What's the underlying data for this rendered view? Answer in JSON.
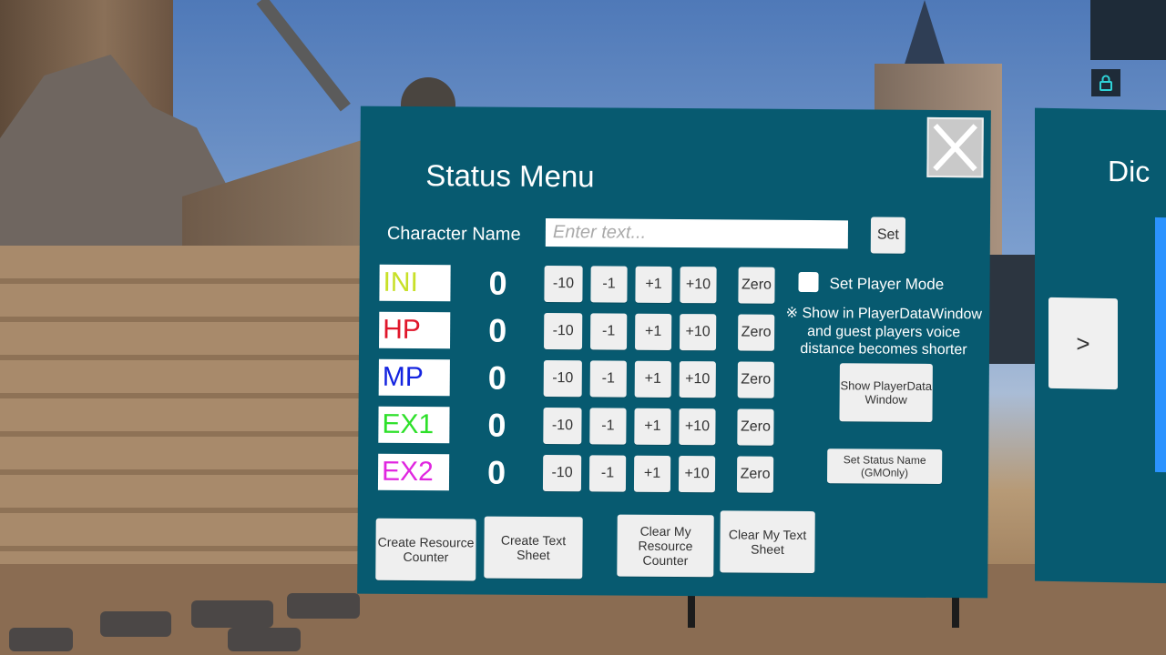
{
  "status_menu": {
    "title": "Status Menu",
    "close_icon": "close-x-icon",
    "character_name": {
      "label": "Character Name",
      "value": "",
      "placeholder": "Enter text...",
      "set_label": "Set"
    },
    "stats": [
      {
        "name": "INI",
        "value": "0",
        "color": "#c8e028"
      },
      {
        "name": "HP",
        "value": "0",
        "color": "#e0162a"
      },
      {
        "name": "MP",
        "value": "0",
        "color": "#1424e0"
      },
      {
        "name": "EX1",
        "value": "0",
        "color": "#2ee02a"
      },
      {
        "name": "EX2",
        "value": "0",
        "color": "#e026e0"
      }
    ],
    "adjust_buttons": {
      "minus10": "-10",
      "minus1": "-1",
      "plus1": "+1",
      "plus10": "+10",
      "zero": "Zero"
    },
    "player_mode": {
      "label": "Set Player Mode",
      "checked": false,
      "note": "※ Show in PlayerDataWindow and guest players voice distance becomes shorter"
    },
    "show_playerdata_window": "Show PlayerData Window",
    "set_status_name": "Set Status Name (GMOnly)",
    "bottom_buttons": {
      "create_resource_counter": "Create Resource Counter",
      "create_text_sheet": "Create Text Sheet",
      "clear_resource_counter": "Clear My Resource Counter",
      "clear_text_sheet": "Clear My Text Sheet"
    }
  },
  "dice_panel": {
    "title": "Dic",
    "next_label": ">"
  },
  "top_right": {
    "lock_icon": "lock-icon",
    "accent": "#2fd3d8"
  },
  "colors": {
    "panel_bg": "#075a70",
    "button_bg": "#efefef"
  }
}
